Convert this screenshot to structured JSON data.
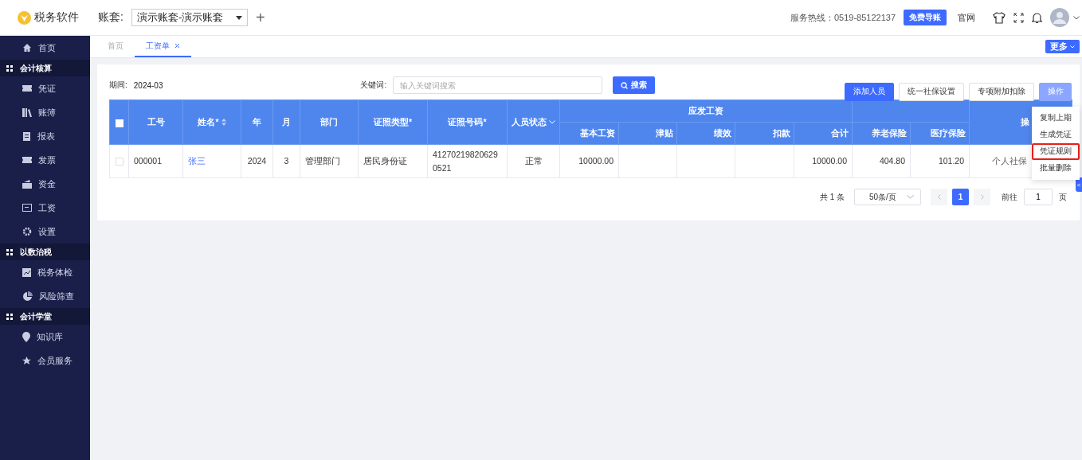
{
  "header": {
    "app_name": "税务软件",
    "account_label": "账套:",
    "account_value": "演示账套-演示账套",
    "add_button": "+",
    "hotline": "服务热线：0519-85122137",
    "import_button": "免费导账",
    "website_link": "官网"
  },
  "sidebar": {
    "items": [
      {
        "kind": "item",
        "label": "首页"
      },
      {
        "kind": "section",
        "label": "会计核算"
      },
      {
        "kind": "item",
        "label": "凭证"
      },
      {
        "kind": "item",
        "label": "账簿"
      },
      {
        "kind": "item",
        "label": "报表"
      },
      {
        "kind": "item",
        "label": "发票"
      },
      {
        "kind": "item",
        "label": "资金"
      },
      {
        "kind": "item",
        "label": "工资"
      },
      {
        "kind": "item",
        "label": "设置"
      },
      {
        "kind": "section",
        "label": "以数治税"
      },
      {
        "kind": "item",
        "label": "税务体检"
      },
      {
        "kind": "item",
        "label": "风险筛查"
      },
      {
        "kind": "section",
        "label": "会计学堂"
      },
      {
        "kind": "item",
        "label": "知识库"
      },
      {
        "kind": "item",
        "label": "会员服务"
      }
    ]
  },
  "tabs": [
    {
      "label": "首页",
      "selected": false,
      "closable": false
    },
    {
      "label": "工资单",
      "selected": true,
      "closable": true
    }
  ],
  "more_button": "更多",
  "toolbar": {
    "period_label": "期间:",
    "period_value": "2024-03",
    "keyword_label": "关键词:",
    "keyword_placeholder": "输入关键词搜索",
    "search_button": "搜索",
    "buttons": [
      {
        "label": "添加人员",
        "kind": "primary"
      },
      {
        "label": "统一社保设置",
        "kind": "plain"
      },
      {
        "label": "专项附加扣除",
        "kind": "plain"
      },
      {
        "label": "操作",
        "kind": "light"
      }
    ]
  },
  "menu": [
    {
      "label": "复制上期",
      "highlighted": false
    },
    {
      "label": "生成凭证",
      "highlighted": false
    },
    {
      "label": "凭证规则",
      "highlighted": true
    },
    {
      "label": "批量删除",
      "highlighted": false
    }
  ],
  "table": {
    "header_checked": false,
    "columns": [
      {
        "label": "工号"
      },
      {
        "label": "姓名*",
        "sortable": true
      },
      {
        "label": "年"
      },
      {
        "label": "月"
      },
      {
        "label": "部门"
      },
      {
        "label": "证照类型*"
      },
      {
        "label": "证照号码*"
      },
      {
        "label": "人员状态",
        "filter": true
      },
      {
        "label": "应发工资",
        "colspan": 5,
        "children": [
          {
            "label": "基本工资"
          },
          {
            "label": "津贴"
          },
          {
            "label": "绩效"
          },
          {
            "label": "扣款"
          },
          {
            "label": "合计"
          }
        ]
      },
      {
        "label": "养老保险",
        "under_blank_group": true
      },
      {
        "label": "医疗保险",
        "under_blank_group": true
      },
      {
        "label": "操"
      }
    ],
    "rows": [
      {
        "checked": false,
        "cells": [
          "000001",
          "张三",
          "2024",
          "3",
          "管理部门",
          "居民身份证",
          "412702198206290521",
          "正常",
          "10000.00",
          null,
          null,
          null,
          "10000.00",
          "404.80",
          "101.20",
          "个人社保"
        ]
      }
    ]
  },
  "pagination": {
    "total": "共 1 条",
    "page_size": "50条/页",
    "pages": [
      {
        "label": "1",
        "selected": true
      }
    ],
    "goto_label": "前往",
    "goto_value": "1",
    "page_suffix": "页"
  },
  "side_tab": "<"
}
